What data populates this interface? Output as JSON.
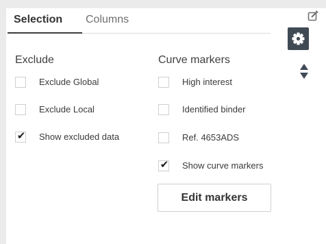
{
  "tabs": [
    {
      "label": "Selection",
      "active": true
    },
    {
      "label": "Columns",
      "active": false
    }
  ],
  "exclude": {
    "title": "Exclude",
    "options": [
      {
        "label": "Exclude Global",
        "checked": false
      },
      {
        "label": "Exclude Local",
        "checked": false
      },
      {
        "label": "Show excluded data",
        "checked": true
      }
    ]
  },
  "curve_markers": {
    "title": "Curve markers",
    "options": [
      {
        "label": "High interest",
        "checked": false
      },
      {
        "label": "Identified binder",
        "checked": false
      },
      {
        "label": "Ref. 4653ADS",
        "checked": false
      },
      {
        "label": "Show curve markers",
        "checked": true
      }
    ],
    "edit_button": "Edit markers"
  },
  "toolbar": {
    "icons": [
      "popout-icon",
      "gear-icon",
      "sort-updown-icon"
    ],
    "accent": "#3f4a55"
  }
}
